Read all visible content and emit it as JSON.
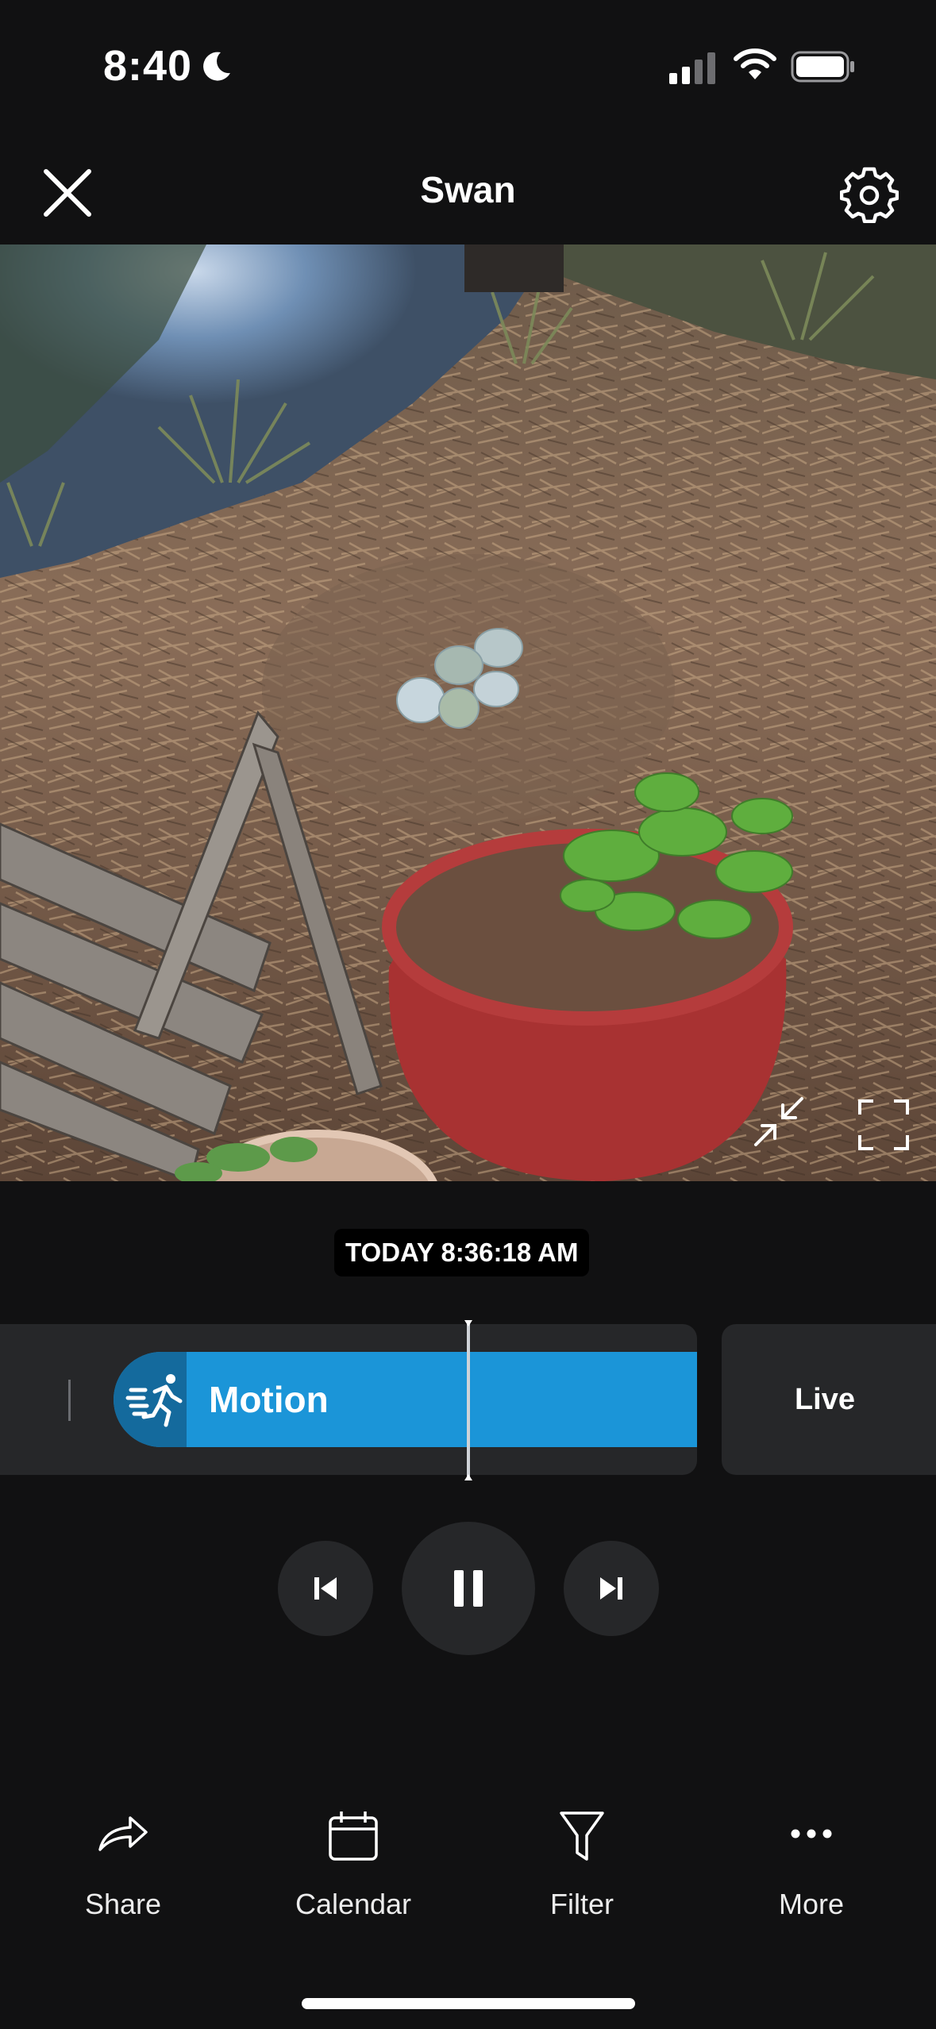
{
  "status_bar": {
    "time": "8:40"
  },
  "header": {
    "title": "Swan"
  },
  "video": {
    "timestamp": "TODAY 8:36:18 AM"
  },
  "timeline": {
    "event_label": "Motion",
    "live_label": "Live"
  },
  "bottom_bar": {
    "items": [
      {
        "label": "Share",
        "icon": "share-icon"
      },
      {
        "label": "Calendar",
        "icon": "calendar-icon"
      },
      {
        "label": "Filter",
        "icon": "filter-icon"
      },
      {
        "label": "More",
        "icon": "more-icon"
      }
    ]
  },
  "colors": {
    "background": "#111112",
    "accent": "#1b95d8",
    "panel": "#262729"
  }
}
